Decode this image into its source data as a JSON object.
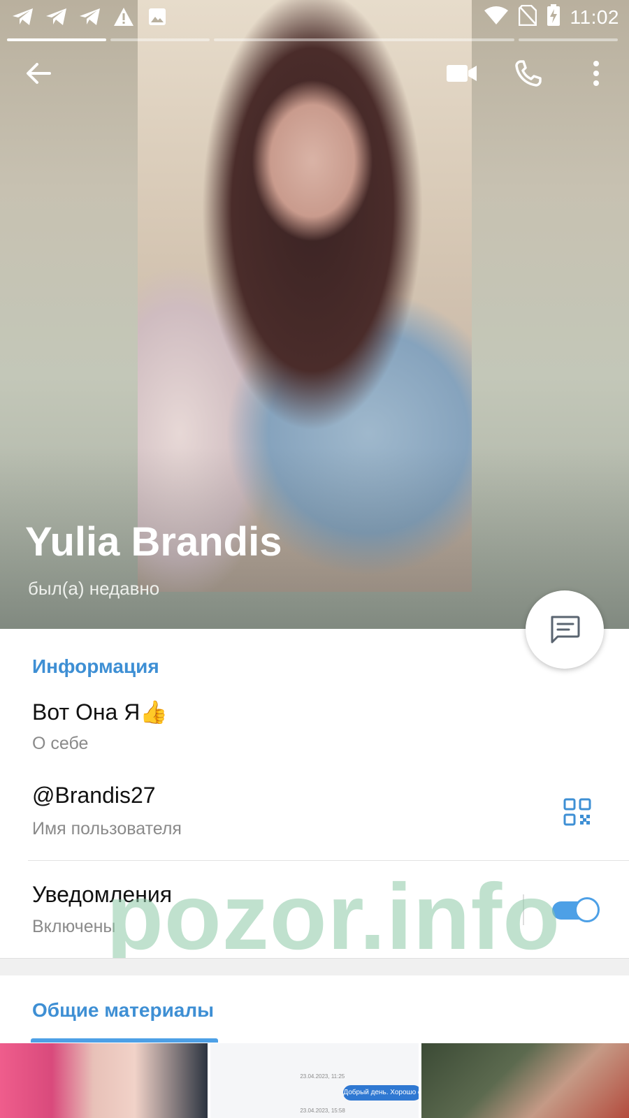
{
  "status_bar": {
    "time": "11:02",
    "left_icons": [
      "telegram-icon",
      "telegram-icon",
      "telegram-icon",
      "warning-icon",
      "image-icon"
    ],
    "right_icons": [
      "wifi-icon",
      "no-sim-icon",
      "battery-charging-icon"
    ]
  },
  "story_progress": {
    "segments": 5,
    "active_index": 0
  },
  "toolbar": {
    "back_icon": "arrow-left-icon",
    "video_icon": "video-call-icon",
    "call_icon": "phone-icon",
    "more_icon": "more-vertical-icon"
  },
  "profile": {
    "name": "Yulia Brandis",
    "last_seen": "был(а) недавно"
  },
  "fab": {
    "icon": "message-icon"
  },
  "info": {
    "section_title": "Информация",
    "bio": "Вот Она Я👍",
    "bio_label": "О себе",
    "username": "@Brandis27",
    "username_label": "Имя пользователя",
    "notifications": "Уведомления",
    "notifications_state": "Включены",
    "notifications_enabled": true
  },
  "watermark": "pozor.info",
  "shared_media": {
    "section_title": "Общие материалы",
    "chat_preview": {
      "timestamp_1": "23.04.2023, 11:25",
      "bubble_text": "Добрый день. Хорошо если в",
      "timestamp_2": "23.04.2023, 15:58"
    }
  },
  "colors": {
    "accent": "#3e8fd4",
    "toggle": "#4da0e6",
    "watermark": "#8cc8a5"
  }
}
